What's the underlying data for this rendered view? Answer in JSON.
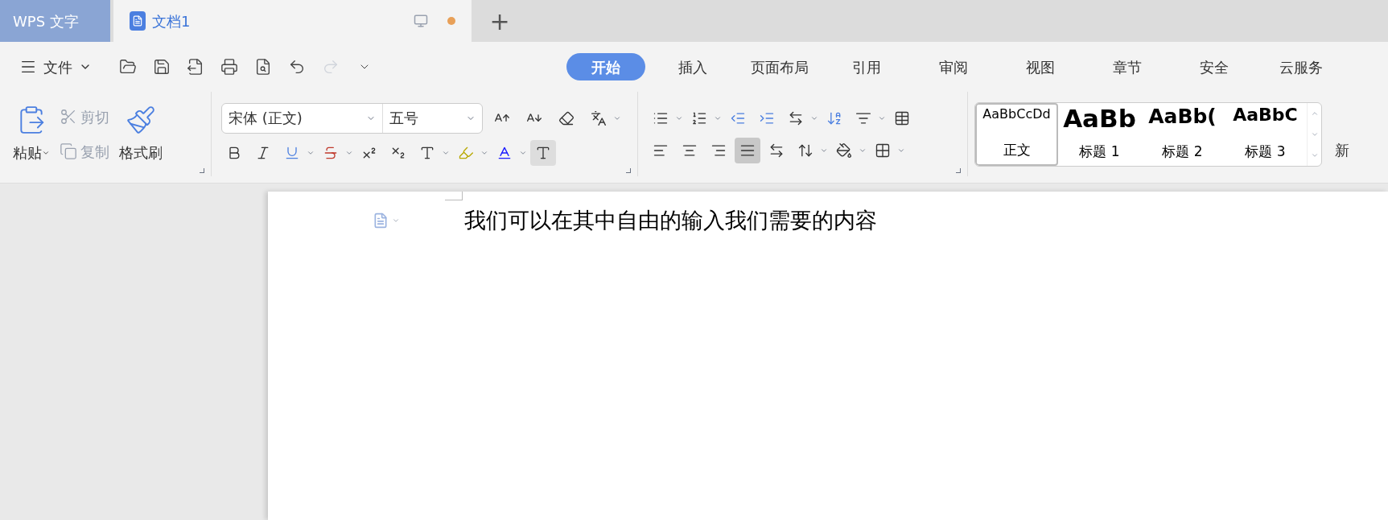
{
  "app_tab": {
    "label": "WPS 文字"
  },
  "document_tab": {
    "title": "文档1",
    "unsaved": true
  },
  "new_tab": {
    "label": "+"
  },
  "file_menu": {
    "label": "文件"
  },
  "quick_access": [
    {
      "kind": "open",
      "disabled": false
    },
    {
      "kind": "save",
      "disabled": false
    },
    {
      "kind": "export",
      "disabled": false
    },
    {
      "kind": "print",
      "disabled": false
    },
    {
      "kind": "preview",
      "disabled": false
    },
    {
      "kind": "undo",
      "disabled": false
    },
    {
      "kind": "redo",
      "disabled": true
    },
    {
      "kind": "more",
      "disabled": false
    }
  ],
  "ribbon_tabs": [
    {
      "label": "开始",
      "selected": true
    },
    {
      "label": "插入",
      "selected": false
    },
    {
      "label": "页面布局",
      "selected": false
    },
    {
      "label": "引用",
      "selected": false
    },
    {
      "label": "审阅",
      "selected": false
    },
    {
      "label": "视图",
      "selected": false
    },
    {
      "label": "章节",
      "selected": false
    },
    {
      "label": "安全",
      "selected": false
    },
    {
      "label": "云服务",
      "selected": false
    }
  ],
  "clipboard": {
    "paste": "粘贴",
    "cut": {
      "label": "剪切",
      "disabled": true
    },
    "copy": {
      "label": "复制",
      "disabled": true
    },
    "format_painter": "格式刷"
  },
  "font": {
    "name": "宋体 (正文)",
    "size": "五号"
  },
  "paragraph_tools": [
    {
      "kind": "justify",
      "selected": true
    }
  ],
  "styles": [
    {
      "preview": "AaBbCcDd",
      "label": "正文",
      "kind": "body",
      "selected": true
    },
    {
      "preview": "AaBb",
      "label": "标题 1",
      "kind": "h1",
      "selected": false
    },
    {
      "preview": "AaBb(",
      "label": "标题 2",
      "kind": "h2",
      "selected": false
    },
    {
      "preview": "AaBbC",
      "label": "标题 3",
      "kind": "h3",
      "selected": false
    }
  ],
  "new_style": {
    "label": "新"
  },
  "document": {
    "text": "我们可以在其中自由的输入我们需要的内容"
  }
}
